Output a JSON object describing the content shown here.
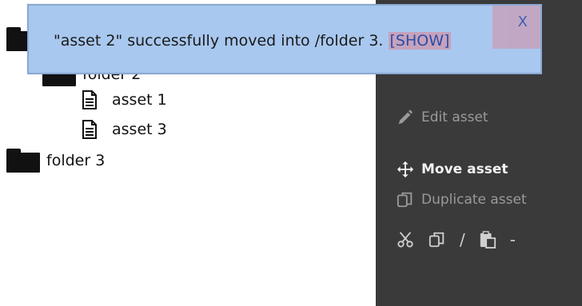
{
  "tree": {
    "items": [
      {
        "type": "folder",
        "label": ""
      },
      {
        "type": "folder",
        "label": "folder 2"
      },
      {
        "type": "file",
        "label": "asset 1"
      },
      {
        "type": "file",
        "label": "asset 3"
      },
      {
        "type": "folder",
        "label": "folder 3"
      }
    ]
  },
  "panel": {
    "edit_label": "Edit asset",
    "move_label": "Move asset",
    "duplicate_label": "Duplicate asset",
    "separator": "/",
    "trailing": "-"
  },
  "toast": {
    "message": "\"asset 2\" successfully moved into /folder 3.",
    "link_label": "[SHOW]",
    "close_label": "X"
  },
  "colors": {
    "panel_bg": "#3a3a3a",
    "toast_bg": "#a9c8ef",
    "highlight": "#c6a2bc"
  }
}
